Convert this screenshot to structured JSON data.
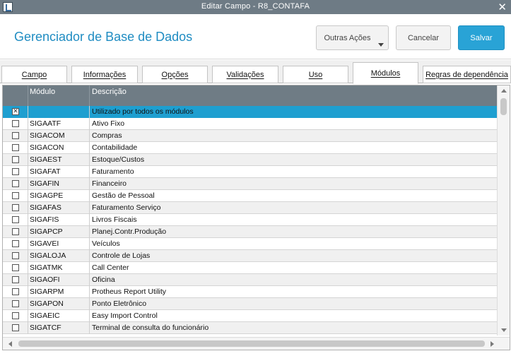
{
  "window": {
    "title": "Editar Campo - R8_CONTAFA",
    "close_glyph": "✕"
  },
  "header": {
    "title": "Gerenciador de Base de Dados",
    "more_actions_label": "Outras Ações",
    "cancel_label": "Cancelar",
    "save_label": "Salvar"
  },
  "colors": {
    "accent": "#29a3d6",
    "title_blue": "#1f8cc2",
    "titlebar": "#6e7b85",
    "grid_header": "#6f7c85",
    "selected_row": "#1e9fd0"
  },
  "tabs": [
    {
      "label": "Campo",
      "active": false
    },
    {
      "label": "Informações",
      "active": false
    },
    {
      "label": "Opções",
      "active": false
    },
    {
      "label": "Validações",
      "active": false
    },
    {
      "label": "Uso",
      "active": false
    },
    {
      "label": "Módulos",
      "active": true
    },
    {
      "label": "Regras de dependência",
      "active": false
    }
  ],
  "grid": {
    "columns": [
      "",
      "Módulo",
      "Descrição"
    ],
    "rows": [
      {
        "checked": true,
        "module": "",
        "description": "Utilizado por todos os módulos",
        "selected": true
      },
      {
        "checked": false,
        "module": "SIGAATF",
        "description": "Ativo Fixo"
      },
      {
        "checked": false,
        "module": "SIGACOM",
        "description": "Compras"
      },
      {
        "checked": false,
        "module": "SIGACON",
        "description": "Contabilidade"
      },
      {
        "checked": false,
        "module": "SIGAEST",
        "description": "Estoque/Custos"
      },
      {
        "checked": false,
        "module": "SIGAFAT",
        "description": "Faturamento"
      },
      {
        "checked": false,
        "module": "SIGAFIN",
        "description": "Financeiro"
      },
      {
        "checked": false,
        "module": "SIGAGPE",
        "description": "Gestão de Pessoal"
      },
      {
        "checked": false,
        "module": "SIGAFAS",
        "description": "Faturamento Serviço"
      },
      {
        "checked": false,
        "module": "SIGAFIS",
        "description": "Livros Fiscais"
      },
      {
        "checked": false,
        "module": "SIGAPCP",
        "description": "Planej.Contr.Produção"
      },
      {
        "checked": false,
        "module": "SIGAVEI",
        "description": "Veículos"
      },
      {
        "checked": false,
        "module": "SIGALOJA",
        "description": "Controle de Lojas"
      },
      {
        "checked": false,
        "module": "SIGATMK",
        "description": "Call Center"
      },
      {
        "checked": false,
        "module": "SIGAOFI",
        "description": "Oficina"
      },
      {
        "checked": false,
        "module": "SIGARPM",
        "description": "Protheus Report Utility"
      },
      {
        "checked": false,
        "module": "SIGAPON",
        "description": "Ponto Eletrônico"
      },
      {
        "checked": false,
        "module": "SIGAEIC",
        "description": "Easy Import Control"
      },
      {
        "checked": false,
        "module": "SIGATCF",
        "description": "Terminal de consulta do funcionário"
      }
    ]
  }
}
